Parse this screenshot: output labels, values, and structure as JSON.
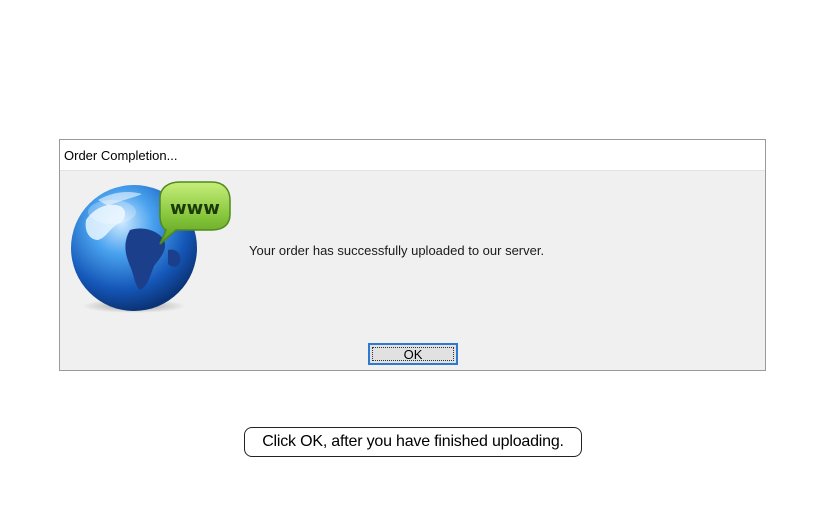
{
  "dialog": {
    "title": "Order Completion...",
    "message": "Your order has successfully uploaded to our server.",
    "ok_label": "OK",
    "icon": "globe-www-icon",
    "bubble_text": "www"
  },
  "hint": {
    "text": "Click OK, after you have finished uploading."
  },
  "colors": {
    "globe_blue": "#1e6fd0",
    "bubble_green": "#7fc23a",
    "button_border": "#2e7ad1",
    "dialog_bg": "#f0f0f0"
  }
}
